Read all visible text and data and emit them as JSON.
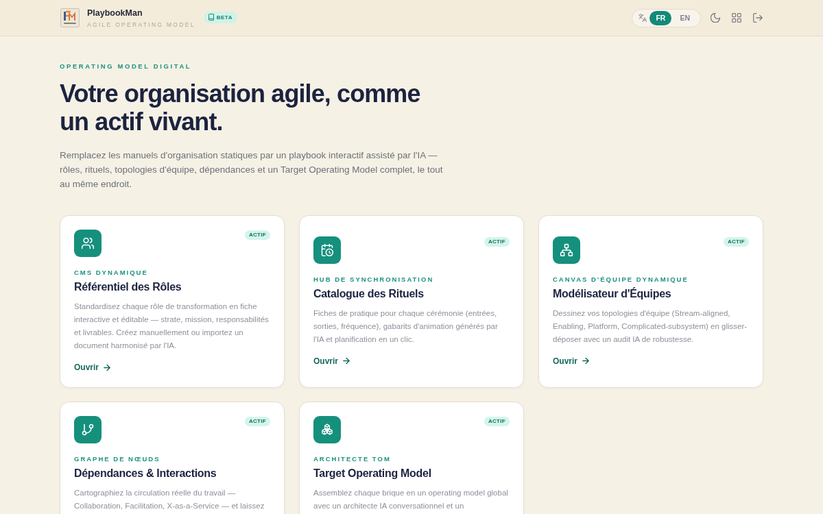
{
  "header": {
    "brand": {
      "name": "PlaybookMan",
      "tagline": "AGILE OPERATING MODEL"
    },
    "badge": "BETA",
    "languages": [
      {
        "label": "FR",
        "selected": true
      },
      {
        "label": "EN",
        "selected": false
      }
    ]
  },
  "hero": {
    "eyebrow": "OPERATING MODEL DIGITAL",
    "title": "Votre organisation agile, comme un actif vivant.",
    "description": "Remplacez les manuels d'organisation statiques par un playbook interactif assisté par l'IA — rôles, rituels, topologies d'équipe, dépendances et un Target Operating Model complet, le tout au même endroit."
  },
  "modules": [
    {
      "status": "ACTIF",
      "category": "CMS DYNAMIQUE",
      "title": "Référentiel des Rôles",
      "description": "Standardisez chaque rôle de transformation en fiche interactive et éditable — strate, mission, responsabilités et livrables. Créez manuellement ou importez un document harmonisé par l'IA.",
      "link": "Ouvrir"
    },
    {
      "status": "ACTIF",
      "category": "HUB DE SYNCHRONISATION",
      "title": "Catalogue des Rituels",
      "description": "Fiches de pratique pour chaque cérémonie (entrées, sorties, fréquence), gabarits d'animation générés par l'IA et planification en un clic.",
      "link": "Ouvrir"
    },
    {
      "status": "ACTIF",
      "category": "CANVAS D'ÉQUIPE DYNAMIQUE",
      "title": "Modélisateur d'Équipes",
      "description": "Dessinez vos topologies d'équipe (Stream-aligned, Enabling, Platform, Complicated-subsystem) en glisser-déposer avec un audit IA de robustesse.",
      "link": "Ouvrir"
    },
    {
      "status": "ACTIF",
      "category": "GRAPHE DE NŒUDS",
      "title": "Dépendances & Interactions",
      "description": "Cartographiez la circulation réelle du travail — Collaboration, Facilitation, X-as-a-Service — et laissez"
    },
    {
      "status": "ACTIF",
      "category": "ARCHITECTE TOM",
      "title": "Target Operating Model",
      "description": "Assemblez chaque brique en un operating model global avec un architecte IA conversationnel et un"
    }
  ]
}
